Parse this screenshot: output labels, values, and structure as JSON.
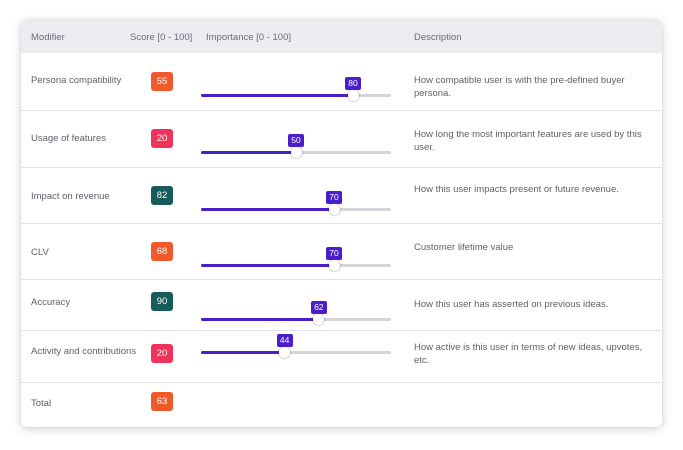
{
  "table": {
    "headers": {
      "modifier": "Modifier",
      "score": "Score [0 - 100]",
      "importance": "Importance [0 - 100]",
      "description": "Description"
    },
    "rows": [
      {
        "name": "Persona compatibility",
        "score": "55",
        "score_color": "#f05a2a",
        "importance": 80,
        "importance_label": "80",
        "description": "How compatible user is with the pre-defined buyer persona."
      },
      {
        "name": "Usage of features",
        "score": "20",
        "score_color": "#f0335a",
        "importance": 50,
        "importance_label": "50",
        "description": "How long the most important features are used by this user."
      },
      {
        "name": "Impact on revenue",
        "score": "82",
        "score_color": "#155c5a",
        "importance": 70,
        "importance_label": "70",
        "description": "How this user impacts present or future revenue."
      },
      {
        "name": "CLV",
        "score": "68",
        "score_color": "#f05a2a",
        "importance": 70,
        "importance_label": "70",
        "description": "Customer lifetime value"
      },
      {
        "name": "Accuracy",
        "score": "90",
        "score_color": "#155c5a",
        "importance": 62,
        "importance_label": "62",
        "description": "How this user has asserted on previous ideas."
      },
      {
        "name": "Activity and contributions",
        "score": "20",
        "score_color": "#f0335a",
        "importance": 44,
        "importance_label": "44",
        "description": "How active is this user in terms of new ideas, upvotes, etc."
      }
    ],
    "total": {
      "name": "Total",
      "score": "63",
      "score_color": "#f05a2a"
    }
  },
  "colors": {
    "accent": "#4a1fc9",
    "header_bg": "#ececf0",
    "track": "#d4d4da"
  }
}
